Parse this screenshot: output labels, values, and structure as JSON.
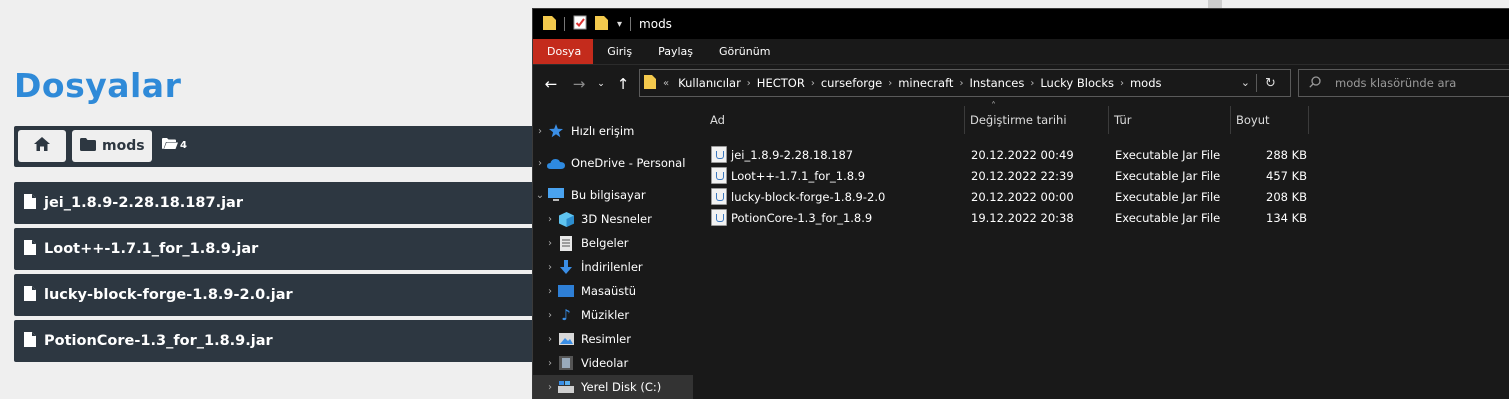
{
  "web": {
    "title": "Dosyalar",
    "breadcrumb": {
      "folder": "mods",
      "count": "4"
    },
    "files": [
      "jei_1.8.9-2.28.18.187.jar",
      "Loot++-1.7.1_for_1.8.9.jar",
      "lucky-block-forge-1.8.9-2.0.jar",
      "PotionCore-1.3_for_1.8.9.jar"
    ]
  },
  "explorer": {
    "window_title": "mods",
    "ribbon_tabs": [
      "Dosya",
      "Giriş",
      "Paylaş",
      "Görünüm"
    ],
    "address": {
      "prefix": "«",
      "segments": [
        "Kullanıcılar",
        "HECTOR",
        "curseforge",
        "minecraft",
        "Instances",
        "Lucky Blocks",
        "mods"
      ]
    },
    "search_placeholder": "mods klasöründe ara",
    "sidebar": {
      "quick": "Hızlı erişim",
      "onedrive": "OneDrive - Personal",
      "pc": "Bu bilgisayar",
      "items": [
        "3D Nesneler",
        "Belgeler",
        "İndirilenler",
        "Masaüstü",
        "Müzikler",
        "Resimler",
        "Videolar",
        "Yerel Disk (C:)"
      ]
    },
    "columns": {
      "name": "Ad",
      "date": "Değiştirme tarihi",
      "type": "Tür",
      "size": "Boyut"
    },
    "files": [
      {
        "name": "jei_1.8.9-2.28.18.187",
        "date": "20.12.2022 00:49",
        "type": "Executable Jar File",
        "size": "288 KB"
      },
      {
        "name": "Loot++-1.7.1_for_1.8.9",
        "date": "20.12.2022 22:39",
        "type": "Executable Jar File",
        "size": "457 KB"
      },
      {
        "name": "lucky-block-forge-1.8.9-2.0",
        "date": "20.12.2022 00:00",
        "type": "Executable Jar File",
        "size": "208 KB"
      },
      {
        "name": "PotionCore-1.3_for_1.8.9",
        "date": "19.12.2022 20:38",
        "type": "Executable Jar File",
        "size": "134 KB"
      }
    ]
  },
  "colors": {
    "title_blue": "#2f8ad8",
    "card_dark": "#2d3741",
    "ribbon_active": "#c42b1c",
    "explorer_bg": "#191919"
  }
}
